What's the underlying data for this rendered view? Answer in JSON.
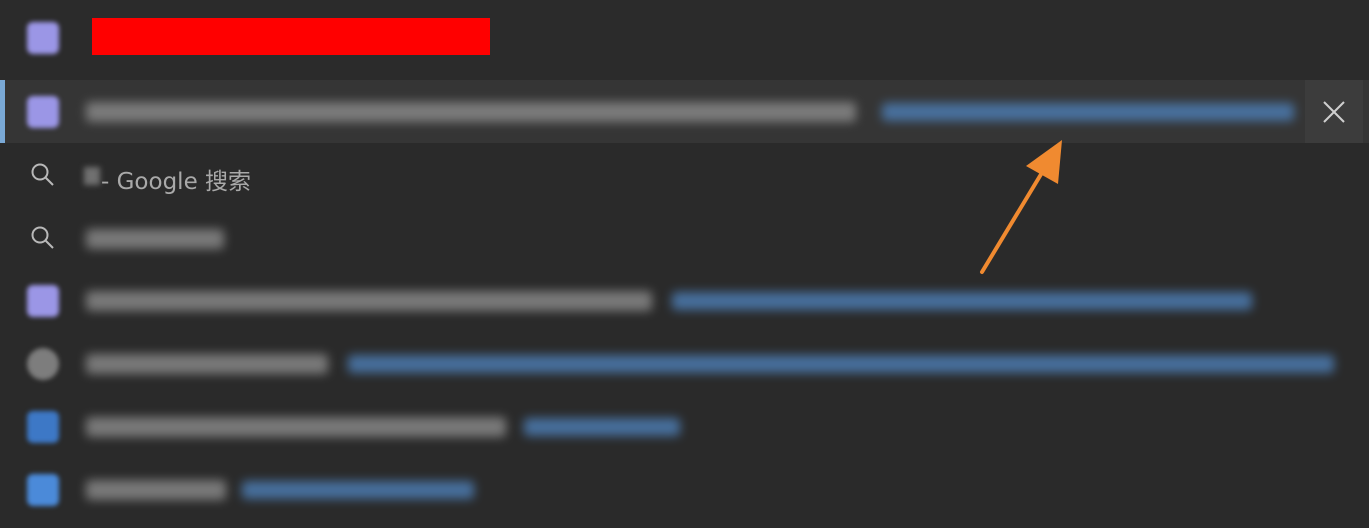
{
  "omnibox": {
    "favicon_icon": "site-favicon-icon",
    "typed_text": "",
    "redaction_color": "#ff0000"
  },
  "suggestions": [
    {
      "type": "history",
      "icon": "site-favicon-icon",
      "title": "",
      "url": "",
      "selected": true,
      "has_remove_button": true,
      "remove_icon": "close-icon"
    },
    {
      "type": "search",
      "icon": "search-icon",
      "query": "",
      "label": "- Google 搜索"
    },
    {
      "type": "search",
      "icon": "search-icon",
      "query": ""
    },
    {
      "type": "history",
      "icon": "site-favicon-icon",
      "title": "",
      "url": ""
    },
    {
      "type": "history",
      "icon": "github-favicon-icon",
      "title": "",
      "url": ""
    },
    {
      "type": "history",
      "icon": "site-favicon-icon",
      "title": "",
      "url": ""
    },
    {
      "type": "history",
      "icon": "google-translate-favicon-icon",
      "title": "",
      "url": ""
    }
  ],
  "annotation": {
    "icon": "arrow-icon",
    "color": "#f08a30"
  },
  "colors": {
    "background": "#2b2b2b",
    "selected_row": "#353535",
    "accent": "#7aa9d6",
    "url_text": "#4c7bb0"
  }
}
